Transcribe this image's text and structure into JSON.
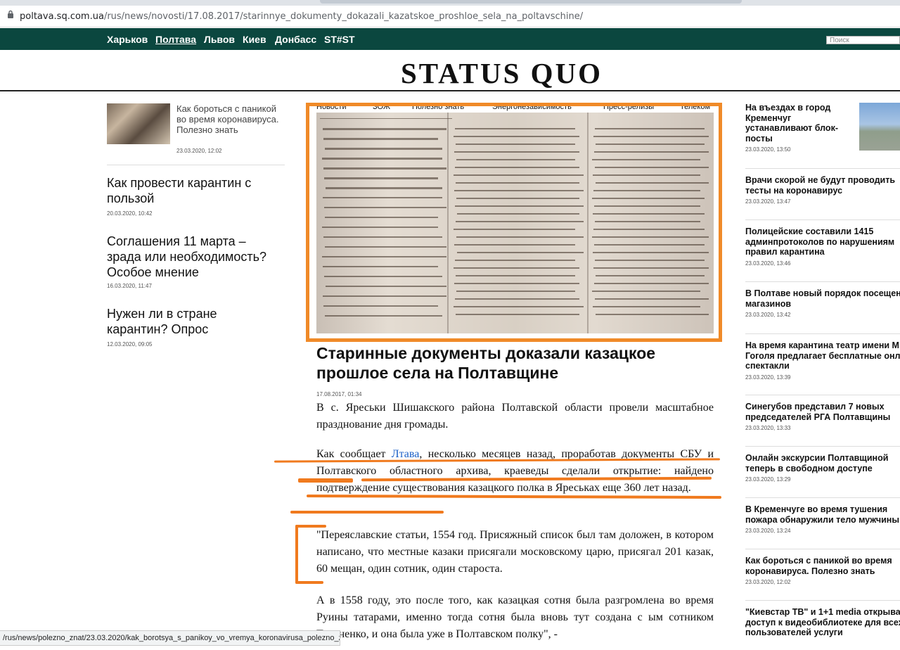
{
  "browser": {
    "url_host": "poltava.sq.com.ua",
    "url_path": "/rus/news/novosti/17.08.2017/starinnye_dokumenty_dokazali_kazatskoe_proshloe_sela_na_poltavschine/",
    "status_url": "/rus/news/polezno_znat/23.03.2020/kak_borotsya_s_panikoy_vo_vremya_koronavirusa_polezno_znat/"
  },
  "nav": {
    "items": [
      "Харьков",
      "Полтава",
      "Львов",
      "Киев",
      "Донбасс",
      "ST#ST"
    ],
    "search_placeholder": "Поиск"
  },
  "logo": "STATUS QUO",
  "category_nav": [
    "Новости",
    "ЗОЖ",
    "Полезно знать",
    "Энергонезависимость",
    "Пресс-релизы",
    "Телеком"
  ],
  "left_column": [
    {
      "title": "Как бороться с паникой во время коронавируса. Полезно знать",
      "date": "23.03.2020, 12:02"
    },
    {
      "title": "Как провести карантин с пользой",
      "date": "20.03.2020, 10:42"
    },
    {
      "title": "Соглашения 11 марта – зрада или необходимость? Особое мнение",
      "date": "16.03.2020, 11:47"
    },
    {
      "title": "Нужен ли в стране карантин? Опрос",
      "date": "12.03.2020, 09:05"
    }
  ],
  "article": {
    "title": "Старинные документы доказали казацкое прошлое села на Полтавщине",
    "date": "17.08.2017, 01:34",
    "p1": "В с. Яреськи Шишакского района Полтавской области провели масштабное празднование дня громады.",
    "p2_before_link": "Как сообщает ",
    "p2_link": "Лтава",
    "p2_after_link": ", несколько месяцев назад, проработав документы СБУ и Полтавского областного архива, краеведы сделали открытие: найдено подтверждение существования казацкого полка в Яреськах еще 360 лет назад.",
    "p3": "\"Переяславские статьи, 1554 год. Присяжный список был там доложен, в котором написано, что местные казаки присягали московскому царю, присягал 201 казак, 60 мещан, один сотник, один староста.",
    "p4": "А в 1558 году, это после того, как казацкая сотня была разгромлена во время Руины татарами, именно тогда сотня была вновь тут создана с ым сотником Тараненко, и она была уже в Полтавском полку\", -"
  },
  "right_column": [
    {
      "title_lines": [
        "На въездах в город",
        "Кременчуг",
        "устанавливают блок-",
        "посты"
      ],
      "date": "23.03.2020, 13:50"
    },
    {
      "title_lines": [
        "Врачи скорой не будут проводить",
        "тесты на коронавирус"
      ],
      "date": "23.03.2020, 13:47"
    },
    {
      "title_lines": [
        "Полицейские составили 1415",
        "админпротоколов по нарушениям",
        "правил карантина"
      ],
      "date": "23.03.2020, 13:46"
    },
    {
      "title_lines": [
        "В Полтаве новый порядок посещения",
        "магазинов"
      ],
      "date": "23.03.2020, 13:42"
    },
    {
      "title_lines": [
        "На время карантина театр имени М",
        "Гоголя предлагает бесплатные онла",
        "спектакли"
      ],
      "date": "23.03.2020, 13:39"
    },
    {
      "title_lines": [
        "Синегубов представил 7 новых",
        "председателей РГА Полтавщины"
      ],
      "date": "23.03.2020, 13:33"
    },
    {
      "title_lines": [
        "Онлайн экскурсии Полтавщиной",
        "теперь в свободном доступе"
      ],
      "date": "23.03.2020, 13:29"
    },
    {
      "title_lines": [
        "В Кременчуге во время тушения",
        "пожара обнаружили тело мужчины"
      ],
      "date": "23.03.2020, 13:24"
    },
    {
      "title_lines": [
        "Как бороться с паникой во время",
        "коронавируса. Полезно знать"
      ],
      "date": "23.03.2020, 12:02"
    },
    {
      "title_lines": [
        "\"Киевстар ТВ\" и 1+1 media открыва",
        "доступ к видеобиблиотеке для всех",
        "пользователей услуги"
      ],
      "date": ""
    }
  ],
  "colors": {
    "nav_bg": "#0b473f",
    "annotation_orange": "#f07a1e",
    "link_blue": "#1a5fc7"
  }
}
